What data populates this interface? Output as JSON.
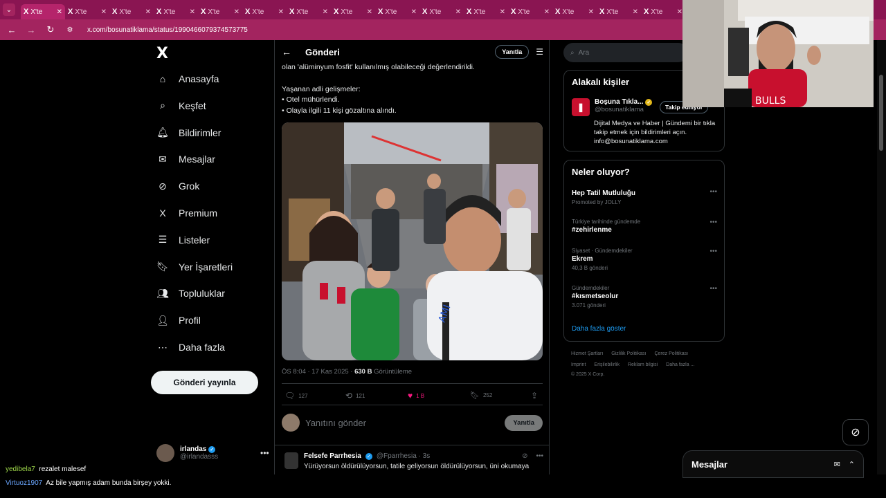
{
  "browser": {
    "tabs": [
      {
        "label": "X'te"
      },
      {
        "label": "X'te"
      },
      {
        "label": "X'te"
      },
      {
        "label": "X'te"
      },
      {
        "label": "X'te"
      },
      {
        "label": "X'te"
      },
      {
        "label": "X'te"
      },
      {
        "label": "X'te"
      },
      {
        "label": "X'te"
      },
      {
        "label": "X'te"
      },
      {
        "label": "X'te"
      },
      {
        "label": "X'te"
      },
      {
        "label": "X'te"
      },
      {
        "label": "X'te"
      },
      {
        "label": "X'te"
      }
    ],
    "url": "x.com/bosunatiklama/status/1990466079374573775",
    "accent_color": "#a3245f"
  },
  "sidebar": {
    "logo": "X",
    "items": [
      {
        "label": "Anasayfa",
        "icon": "home-icon"
      },
      {
        "label": "Keşfet",
        "icon": "search-icon"
      },
      {
        "label": "Bildirimler",
        "icon": "bell-icon"
      },
      {
        "label": "Mesajlar",
        "icon": "mail-icon"
      },
      {
        "label": "Grok",
        "icon": "grok-icon"
      },
      {
        "label": "Premium",
        "icon": "x-premium-icon"
      },
      {
        "label": "Listeler",
        "icon": "list-icon"
      },
      {
        "label": "Yer İşaretleri",
        "icon": "bookmark-icon"
      },
      {
        "label": "Topluluklar",
        "icon": "communities-icon"
      },
      {
        "label": "Profil",
        "icon": "profile-icon"
      },
      {
        "label": "Daha fazla",
        "icon": "more-circle-icon"
      }
    ],
    "post_button": "Gönderi yayınla",
    "account": {
      "name": "irlandas",
      "handle": "@irlandasss"
    }
  },
  "post": {
    "header_title": "Gönderi",
    "reply_button": "Yanıtla",
    "text_line1": "olan 'alüminyum fosfit' kullanılmış olabileceği değerlendirildi.",
    "text_line2": "Yaşanan adli gelişmeler:",
    "text_line3": "• Otel mühürlendi.",
    "text_line4": "• Olayla ilgili 11 kişi gözaltına alındı.",
    "time": "ÖS 8:04 · 17 Kas 2025 · ",
    "views_count": "630 B",
    "views_label": " Görüntüleme",
    "actions": {
      "replies": "127",
      "reposts": "121",
      "likes": "1 B",
      "bookmarks": "252"
    },
    "reply_placeholder": "Yanıtını gönder",
    "reply_submit": "Yanıtla"
  },
  "reply": {
    "name": "Felsefe Parrhesia",
    "handle": "@Fparrhesia · 3s",
    "text": "Yürüyorsun öldürülüyorsun, tatile geliyorsun öldürülüyorsun, üni okumaya"
  },
  "right": {
    "search_placeholder": "Ara",
    "people_title": "Alakalı kişiler",
    "person": {
      "name": "Boşuna Tıkla...",
      "handle": "@bosunatiklama",
      "follow": "Takip ediliyor",
      "bio": "Dijital Medya ve Haber | Gündemi bir tıkla takip etmek için bildirimleri açın. info@bosunatiklama.com"
    },
    "trends_title": "Neler oluyor?",
    "trends": [
      {
        "cat": "",
        "name": "Hep Tatil Mutluluğu",
        "count": "Promoted by JOLLY"
      },
      {
        "cat": "Türkiye tarihinde gündemde",
        "name": "#zehirlenme",
        "count": ""
      },
      {
        "cat": "Siyaset · Gündemdekiler",
        "name": "Ekrem",
        "count": "40,3 B gönderi"
      },
      {
        "cat": "Gündemdekiler",
        "name": "#kısmetseolur",
        "count": "3.071 gönderi"
      }
    ],
    "show_more": "Daha fazla göster",
    "footer_line1": [
      "Hizmet Şartları",
      "Gizlilik Politikası",
      "Çerez Politikası"
    ],
    "footer_line2": [
      "Imprint",
      "Erişilebilirlik",
      "Reklam bilgisi",
      "Daha fazla ..."
    ],
    "copyright": "© 2025 X Corp."
  },
  "messages_drawer": {
    "title": "Mesajlar"
  },
  "chat": [
    {
      "user": "yedibela7",
      "text": "rezalet malesef"
    },
    {
      "user": "Virtuoz1907",
      "text": "Az bile yapmış adam bunda birşey yokki."
    }
  ],
  "colors": {
    "like": "#f91880",
    "link": "#1d9bf0",
    "verified": "#1d9bf0"
  }
}
